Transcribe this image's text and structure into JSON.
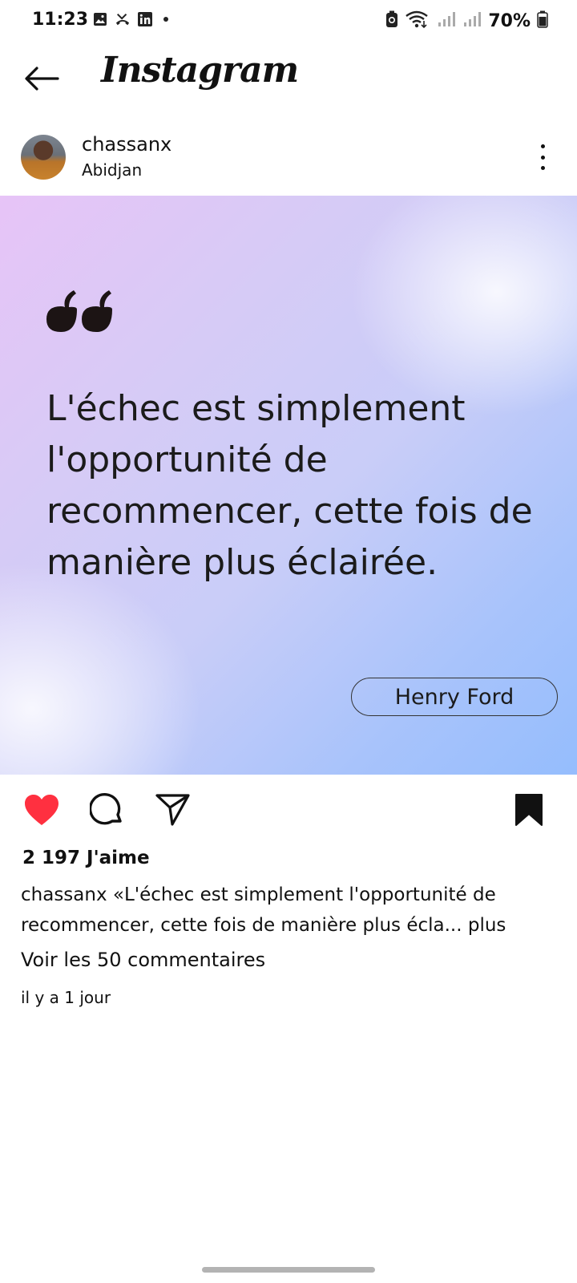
{
  "status_bar": {
    "time": "11:23",
    "battery_text": "70%",
    "battery_level": 0.7,
    "icons": [
      "gallery-icon",
      "missed-call-icon",
      "linkedin-icon",
      "notification-dot",
      "battery-saver-icon",
      "wifi-icon",
      "signal-icon",
      "signal-icon",
      "battery-icon"
    ]
  },
  "app_bar": {
    "title": "Instagram",
    "back_icon": "arrow-left-icon"
  },
  "post": {
    "username": "chassanx",
    "location": "Abidjan",
    "image": {
      "quote": "L'échec est simplement l'opportunité de recommencer, cette fois de manière plus éclairée.",
      "author": "Henry Ford"
    },
    "actions": {
      "liked": true,
      "like_icon": "heart-filled-icon",
      "comment_icon": "comment-icon",
      "share_icon": "send-icon",
      "save_icon": "bookmark-filled-icon"
    },
    "likes_text": "2 197 J'aime",
    "caption_user": "chassanx",
    "caption_text": "«L'échec est simplement l'opportunité de recommencer, cette fois de manière plus écla...",
    "caption_more": "plus",
    "comments_link": "Voir les 50 commentaires",
    "time_ago": "il y a 1 jour"
  },
  "colors": {
    "heart": "#ff3040",
    "text": "#111111",
    "gradient_start": "#e7c4f7",
    "gradient_end": "#95bdfd"
  }
}
